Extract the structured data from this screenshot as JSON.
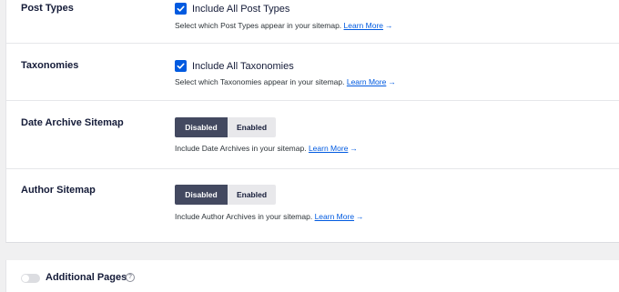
{
  "settings": {
    "post_types": {
      "label": "Post Types",
      "checkbox_label": "Include All Post Types",
      "checked": true,
      "description": "Select which Post Types appear in your sitemap.",
      "link": "Learn More",
      "arrow": "→"
    },
    "taxonomies": {
      "label": "Taxonomies",
      "checkbox_label": "Include All Taxonomies",
      "checked": true,
      "description": "Select which Taxonomies appear in your sitemap.",
      "link": "Learn More",
      "arrow": "→"
    },
    "date_archive": {
      "label": "Date Archive Sitemap",
      "options": [
        "Disabled",
        "Enabled"
      ],
      "selected": "Disabled",
      "description": "Include Date Archives in your sitemap.",
      "link": "Learn More",
      "arrow": "→"
    },
    "author": {
      "label": "Author Sitemap",
      "options": [
        "Disabled",
        "Enabled"
      ],
      "selected": "Disabled",
      "description": "Include Author Archives in your sitemap.",
      "link": "Learn More",
      "arrow": "→"
    }
  },
  "additional_pages": {
    "title": "Additional Pages",
    "enabled": false,
    "help_icon": "question-circle-icon",
    "help_glyph": "?"
  },
  "colors": {
    "accent": "#005ae0",
    "toggle_active": "#434960",
    "toggle_inactive": "#e8e8eb"
  }
}
